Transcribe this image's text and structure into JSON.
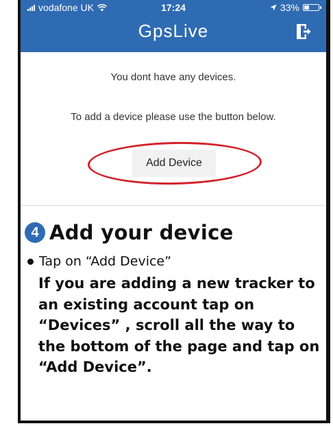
{
  "status_bar": {
    "carrier": "vodafone UK",
    "time": "17:24",
    "battery": "33%",
    "battery_level": 0.33,
    "icons": [
      "signal-icon",
      "wifi-icon",
      "location-arrow-icon",
      "battery-icon"
    ]
  },
  "header": {
    "brand": "GpsLive",
    "background": "#2f6bb3",
    "logout_icon": "logout-icon"
  },
  "main": {
    "empty_message": "You dont have any devices.",
    "add_hint": "To add a device please use the button below.",
    "add_button_label": "Add Device",
    "highlight_color": "#d2232a"
  },
  "instruction": {
    "step_number": "4",
    "title": "Add your device",
    "bullet": "Tap on “Add Device”",
    "paragraph": "If you are adding a new tracker to an existing account tap on “Devices” , scroll all the way to the bottom of the page and tap on “Add Device”."
  }
}
